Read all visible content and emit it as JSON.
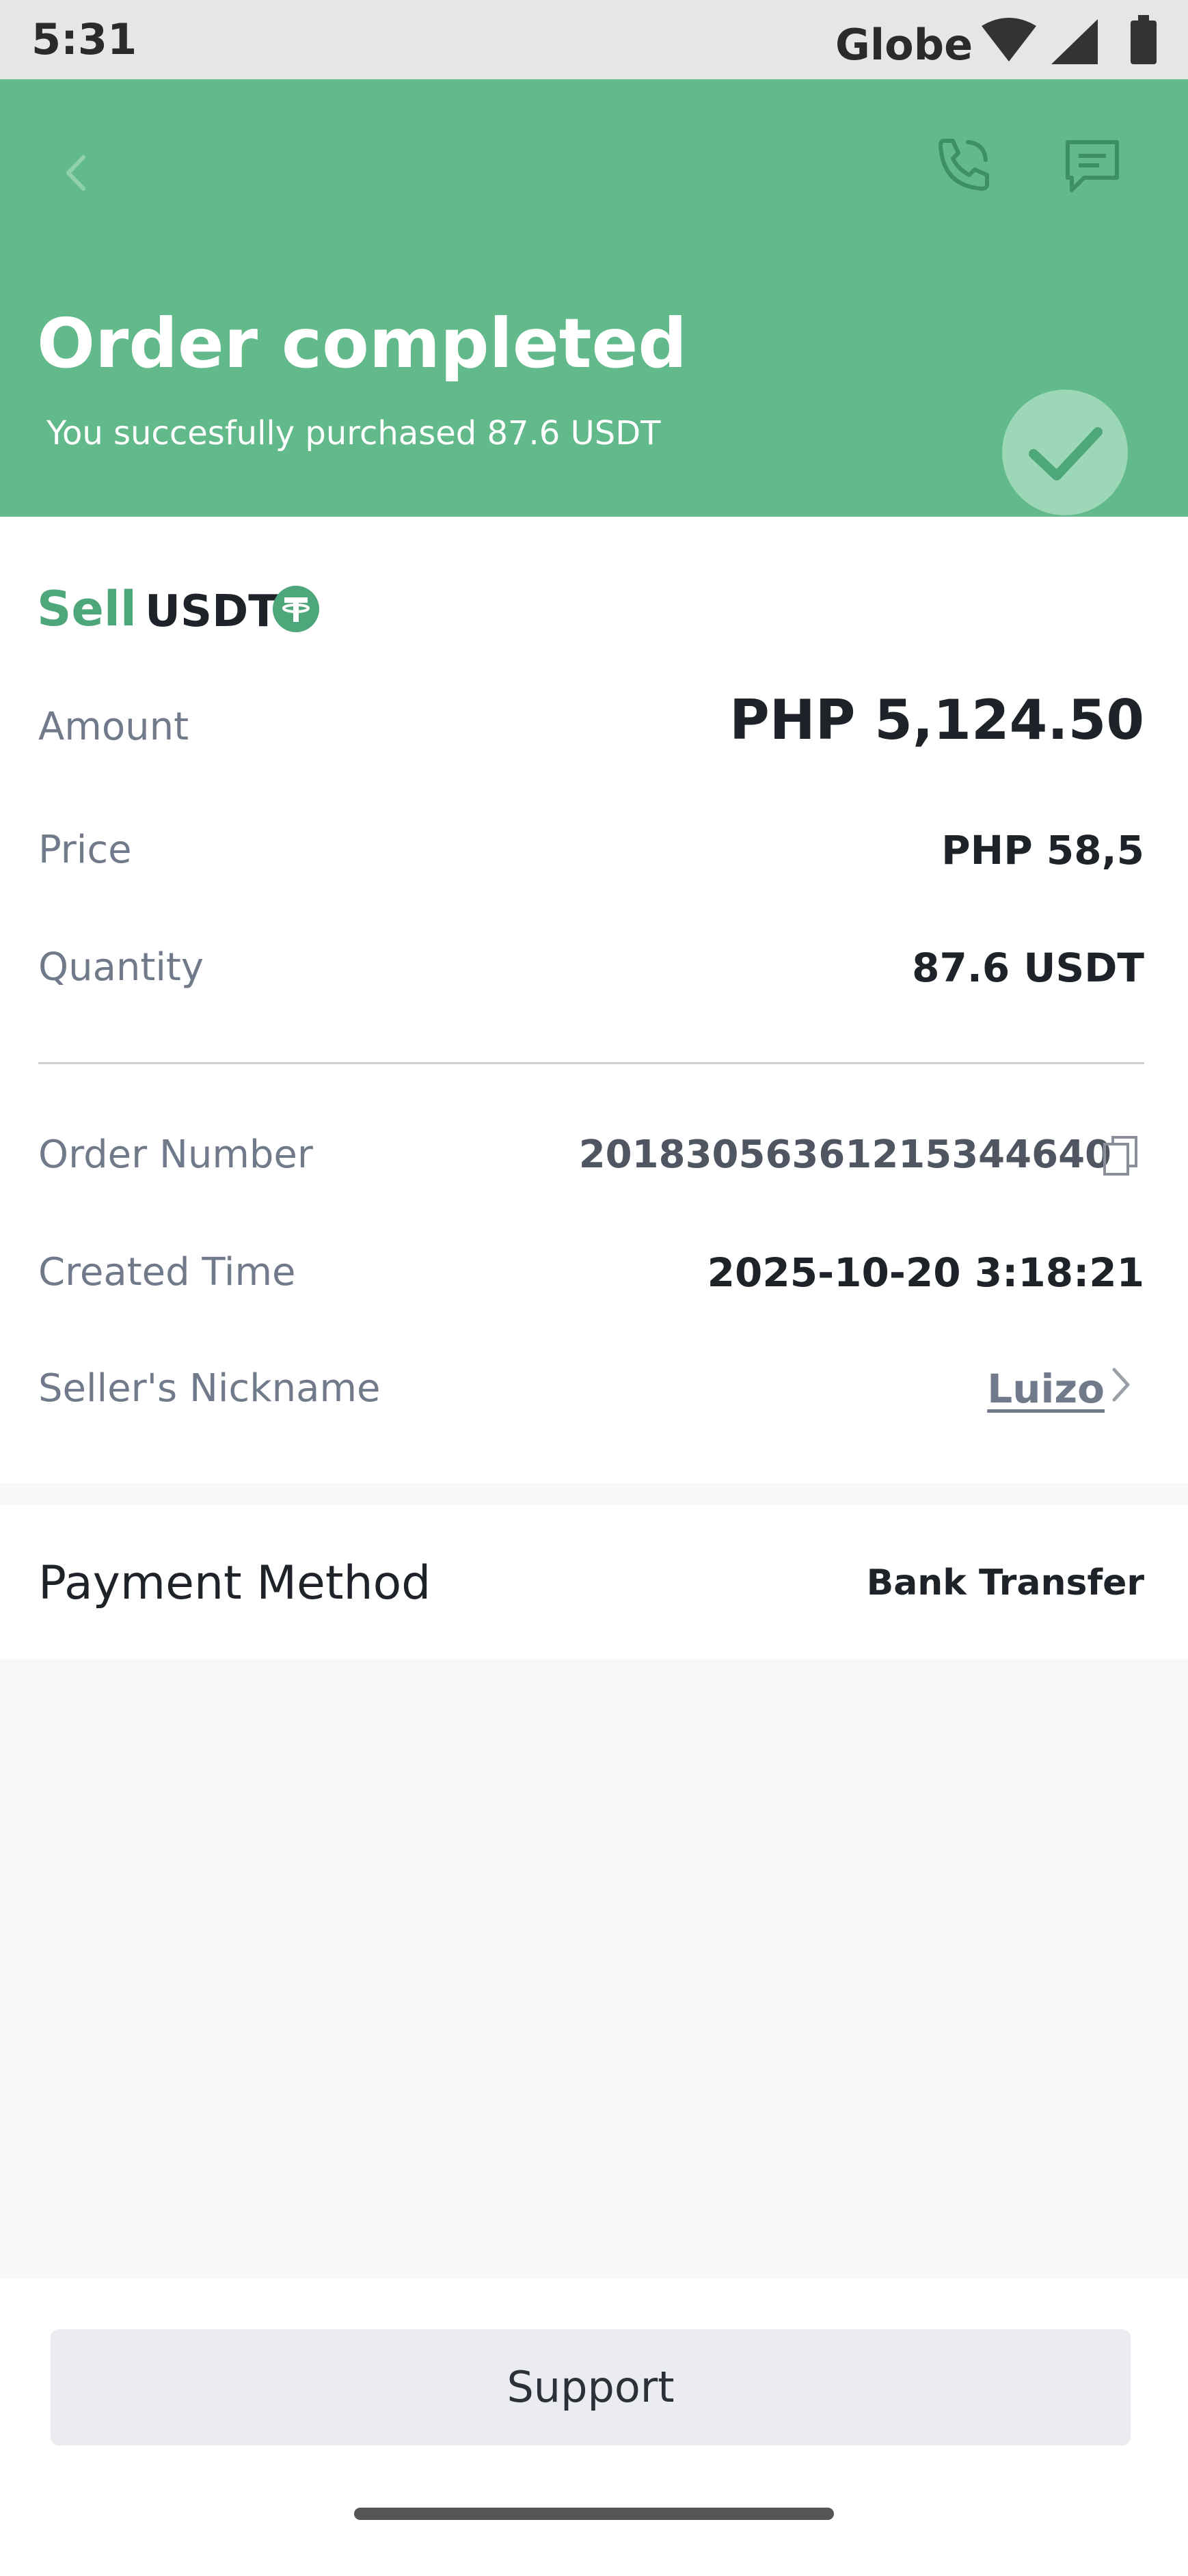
{
  "status_bar": {
    "time": "5:31",
    "carrier": "Globe",
    "icons": [
      "wifi-icon",
      "signal-icon",
      "battery-icon"
    ]
  },
  "header": {
    "back_icon": "chevron-left-icon",
    "call_icon": "phone-icon",
    "chat_icon": "chat-icon",
    "title": "Order completed",
    "subtitle": "You succesfully purchased 87.6 USDT",
    "status_icon": "checkmark-icon",
    "background_color": "#62b98a"
  },
  "order": {
    "side": "Sell",
    "asset": "USDT",
    "asset_icon": "tether-icon",
    "amount_label": "Amount",
    "amount_value": "PHP 5,124.50",
    "price_label": "Price",
    "price_value": "PHP 58,5",
    "quantity_label": "Quantity",
    "quantity_value": "87.6 USDT",
    "order_number_label": "Order Number",
    "order_number_value": "20183056361215344640",
    "created_time_label": "Created Time",
    "created_time_value": "2025-10-20 3:18:21",
    "seller_label": "Seller's Nickname",
    "seller_value": "Luizo"
  },
  "payment": {
    "label": "Payment Method",
    "value": "Bank Transfer"
  },
  "footer": {
    "support_label": "Support"
  }
}
